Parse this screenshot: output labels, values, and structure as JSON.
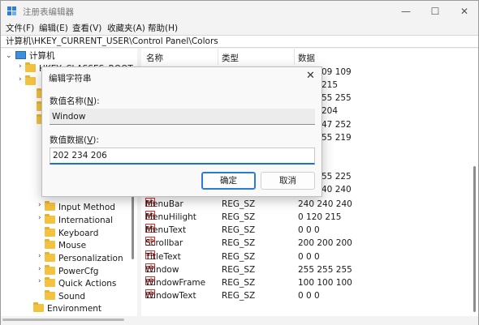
{
  "window": {
    "title": "注册表编辑器",
    "minimize_glyph": "—",
    "maximize_glyph": "☐",
    "close_glyph": "✕"
  },
  "menu": [
    "文件(F)",
    "编辑(E)",
    "查看(V)",
    "收藏夹(A)",
    "帮助(H)"
  ],
  "address": "计算机\\HKEY_CURRENT_USER\\Control Panel\\Colors",
  "tree": {
    "root": "计算机",
    "partial_item": "HKEY_CLASSES_ROOT",
    "items": [
      "Input Method",
      "International",
      "Keyboard",
      "Mouse",
      "Personalization",
      "PowerCfg",
      "Quick Actions",
      "Sound",
      "Environment"
    ]
  },
  "list": {
    "columns": [
      "名称",
      "类型",
      "数据"
    ],
    "partial_values": [
      "09 109",
      "215",
      "55 255",
      "204",
      "47 252",
      "55 219",
      "55 225",
      "40 240"
    ],
    "rows": [
      {
        "name": "MenuBar",
        "type": "REG_SZ",
        "data": "240 240 240"
      },
      {
        "name": "MenuHilight",
        "type": "REG_SZ",
        "data": "0 120 215"
      },
      {
        "name": "MenuText",
        "type": "REG_SZ",
        "data": "0 0 0"
      },
      {
        "name": "Scrollbar",
        "type": "REG_SZ",
        "data": "200 200 200"
      },
      {
        "name": "TitleText",
        "type": "REG_SZ",
        "data": "0 0 0"
      },
      {
        "name": "Window",
        "type": "REG_SZ",
        "data": "255 255 255"
      },
      {
        "name": "WindowFrame",
        "type": "REG_SZ",
        "data": "100 100 100"
      },
      {
        "name": "WindowText",
        "type": "REG_SZ",
        "data": "0 0 0"
      }
    ],
    "icon_label": "ab"
  },
  "dialog": {
    "title": "编辑字符串",
    "close_glyph": "✕",
    "name_label_prefix": "数值名称(",
    "name_label_key": "N",
    "name_label_suffix": "):",
    "name_value": "Window",
    "data_label_prefix": "数值数据(",
    "data_label_key": "V",
    "data_label_suffix": "):",
    "data_value": "202 234 206",
    "ok_label": "确定",
    "cancel_label": "取消"
  },
  "colors": {
    "accent": "#1a6fd6",
    "folder": "#f3c241",
    "icon_red": "#cc3333"
  }
}
